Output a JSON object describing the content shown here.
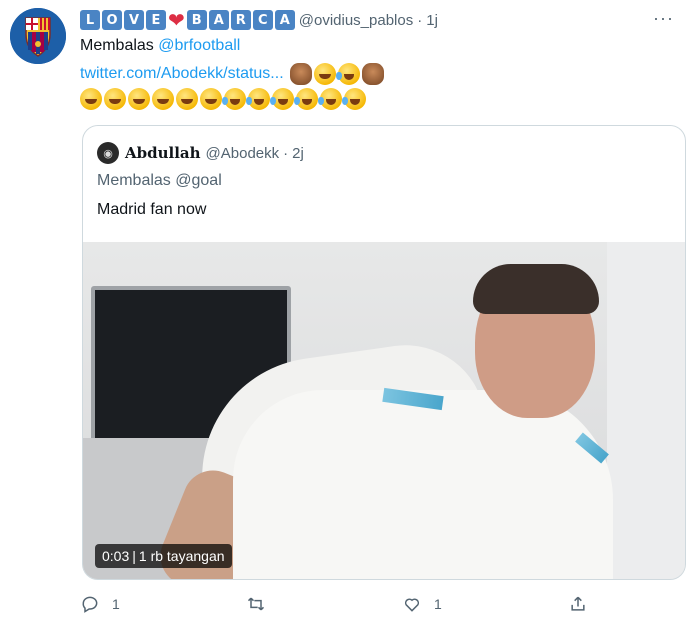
{
  "tweet": {
    "author_letters": [
      "L",
      "O",
      "V",
      "E",
      "B",
      "A",
      "R",
      "C",
      "A"
    ],
    "handle": "@ovidius_pablos",
    "time_sep": "·",
    "time": "1j",
    "more_label": "···",
    "reply_prefix": "Membalas",
    "reply_to": "@brfootball",
    "link": "twitter.com/Abodekk/status...",
    "emoji_row1": [
      "see-no-evil-monkey",
      "grinning-face",
      "tears-of-joy",
      "see-no-evil-monkey"
    ],
    "emoji_row2": [
      "grinning-face",
      "grinning-face",
      "grinning-face",
      "grinning-face",
      "grinning-face",
      "grinning-face",
      "tears-of-joy",
      "tears-of-joy",
      "tears-of-joy",
      "tears-of-joy",
      "tears-of-joy",
      "tears-of-joy"
    ]
  },
  "quoted": {
    "name": "Abdullah",
    "handle": "@Abodekk",
    "time_sep": "·",
    "time": "2j",
    "reply_prefix": "Membalas",
    "reply_to": "@goal",
    "text": "Madrid fan now",
    "video_time": "0:03",
    "video_sep": "|",
    "video_views": "1 rb tayangan"
  },
  "actions": {
    "reply_count": "1",
    "retweet_count": "",
    "like_count": "1"
  },
  "colors": {
    "accent": "#1d9bf0",
    "secondary_text": "#536471",
    "heart": "#dd2e44",
    "letter_block": "#4a84c4"
  }
}
